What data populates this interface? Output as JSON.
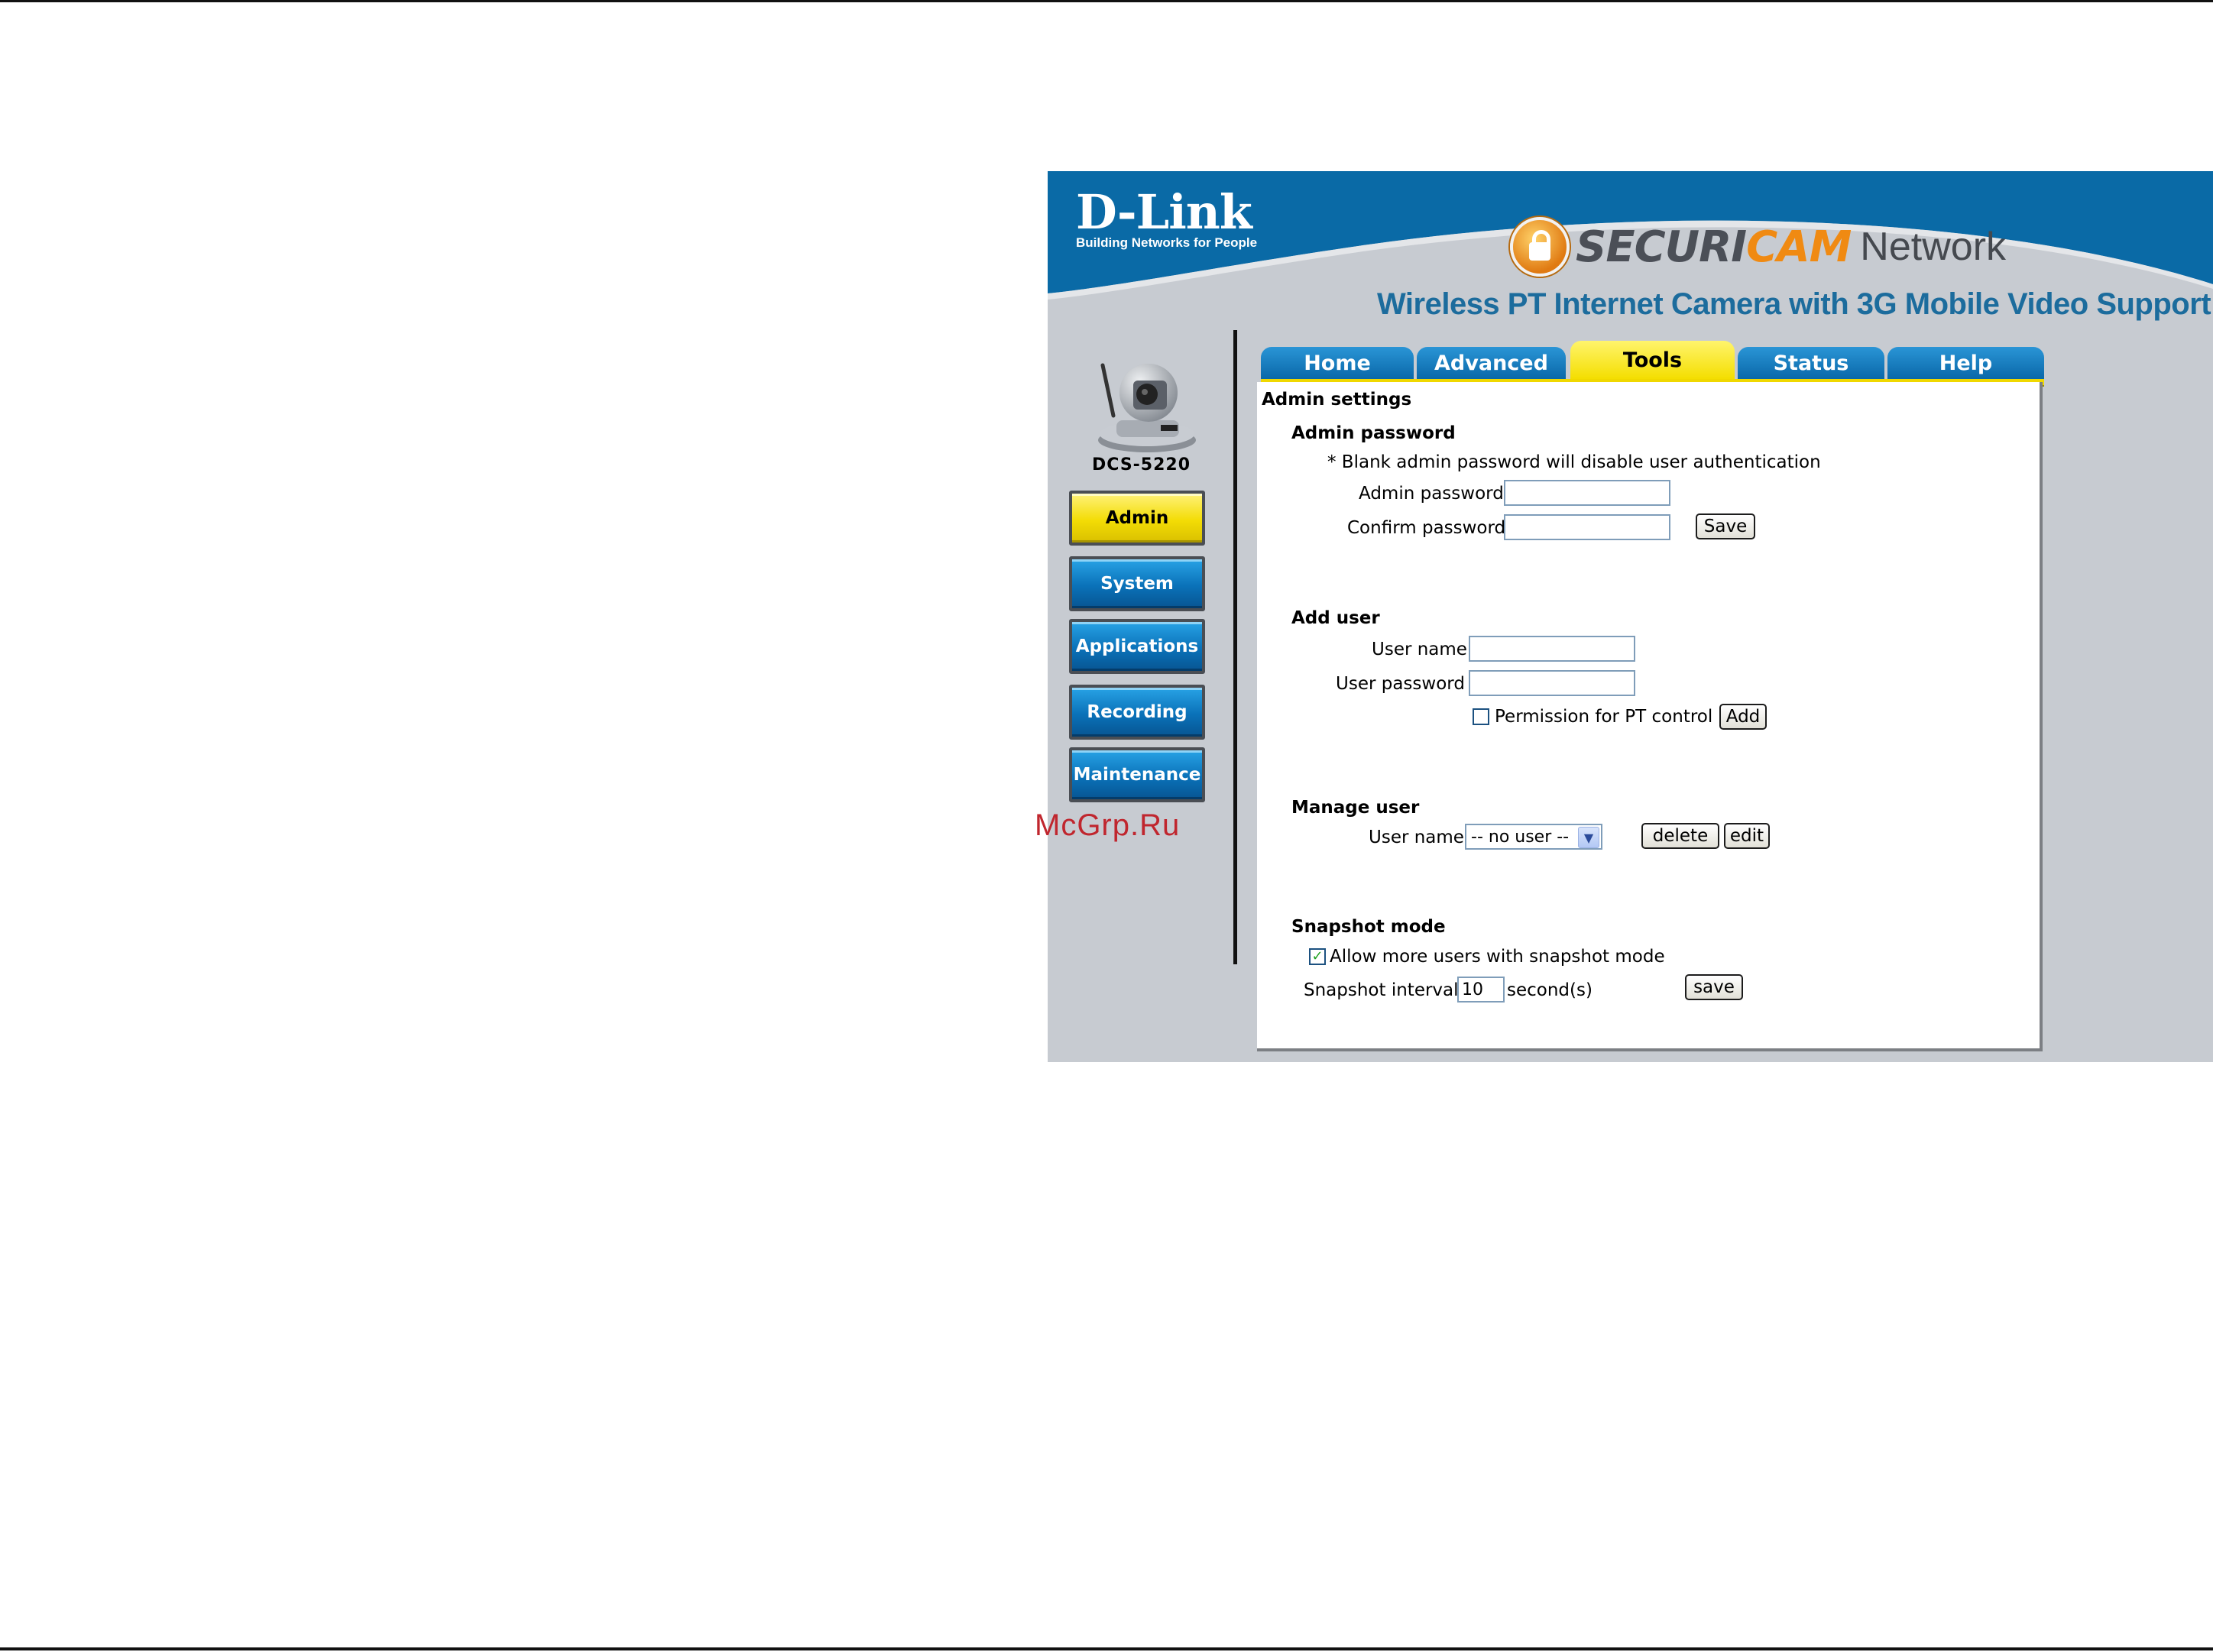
{
  "brand": {
    "name": "D-Link",
    "tagline": "Building Networks for People"
  },
  "product": {
    "securi": "SECURI",
    "cam": "CAM",
    "network": "Network",
    "subtitle": "Wireless PT Internet Camera with 3G Mobile Video Support"
  },
  "device": {
    "model": "DCS-5220"
  },
  "sidebar": {
    "items": [
      {
        "label": "Admin",
        "active": true
      },
      {
        "label": "System",
        "active": false
      },
      {
        "label": "Applications",
        "active": false
      },
      {
        "label": "Recording",
        "active": false
      },
      {
        "label": "Maintenance",
        "active": false
      }
    ]
  },
  "tabs": [
    {
      "label": "Home",
      "active": false
    },
    {
      "label": "Advanced",
      "active": false
    },
    {
      "label": "Tools",
      "active": true
    },
    {
      "label": "Status",
      "active": false
    },
    {
      "label": "Help",
      "active": false
    }
  ],
  "admin": {
    "title": "Admin settings",
    "password_section": {
      "heading": "Admin password",
      "note": "* Blank admin password will disable user authentication",
      "admin_password_label": "Admin password",
      "admin_password_value": "",
      "confirm_password_label": "Confirm password",
      "confirm_password_value": "",
      "save_label": "Save"
    },
    "add_user": {
      "heading": "Add user",
      "user_name_label": "User name",
      "user_name_value": "",
      "user_password_label": "User password",
      "user_password_value": "",
      "permission_label": "Permission for PT control",
      "permission_checked": false,
      "add_label": "Add"
    },
    "manage_user": {
      "heading": "Manage user",
      "user_name_label": "User name",
      "selected_user": "-- no user --",
      "delete_label": "delete",
      "edit_label": "edit"
    },
    "snapshot": {
      "heading": "Snapshot mode",
      "allow_label": "Allow more users with snapshot mode",
      "allow_checked": true,
      "interval_label": "Snapshot interval",
      "interval_value": "10",
      "interval_unit": "second(s)",
      "save_label": "save"
    }
  },
  "watermark": "McGrp.Ru",
  "colors": {
    "header_blue": "#0a6aa6",
    "tab_yellow": "#f4de00",
    "panel_gray": "#c7cbd1",
    "subtitle_blue": "#1c6c9d"
  }
}
